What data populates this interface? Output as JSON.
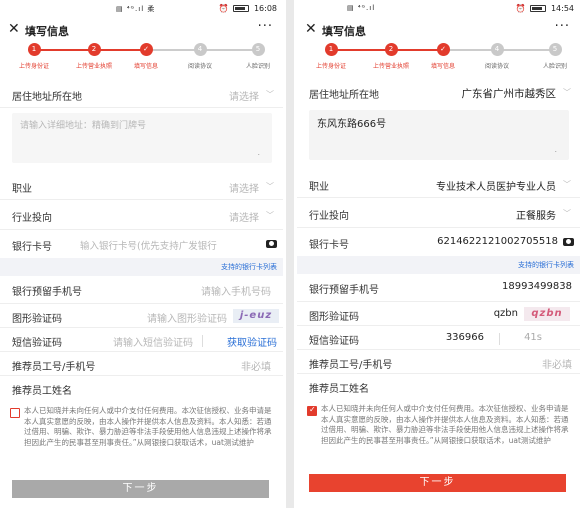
{
  "accent": "#e23b2c",
  "link_color": "#2a6fd6",
  "steps": [
    "上传身份证",
    "上传营业执照",
    "填写信息",
    "阅读协议",
    "人脸识别"
  ],
  "left": {
    "status": {
      "signal": "▤ ⁴ᴳ.ıl 柔",
      "time": "16:08",
      "battery_fraction": 0.7
    },
    "nav": {
      "close": "✕",
      "title": "填写信息",
      "more": "···"
    },
    "residence": {
      "label": "居住地址所在地",
      "value": "请选择"
    },
    "address_placeholder": "请输入详细地址：精确到门牌号",
    "occupation": {
      "label": "职业",
      "value": "请选择"
    },
    "industry": {
      "label": "行业投向",
      "value": "请选择"
    },
    "bank_card": {
      "label": "银行卡号",
      "placeholder": "输入银行卡号(优先支持广发银行"
    },
    "bank_hint": "支持的银行卡列表",
    "reserved_phone": {
      "label": "银行预留手机号",
      "placeholder": "请输入手机号码"
    },
    "captcha": {
      "label": "图形验证码",
      "placeholder": "请输入图形验证码",
      "image_text": "j-euz"
    },
    "sms": {
      "label": "短信验证码",
      "placeholder": "请输入短信验证码",
      "button": "获取验证码"
    },
    "referrer_id": {
      "label": "推荐员工号/手机号",
      "placeholder": "非必填"
    },
    "referrer_name": {
      "label": "推荐员工姓名"
    },
    "agreement": "本人已知晓并未向任何人或中介支付任何费用。本次征信授权、业务申请是本人真实意愿的反映，由本人操作并提供本人信息及资料。本人知悉：若通过借用、明骗、欺诈、暴力胁迫等非法手段使用他人信息违规上述操作将承担因此产生的民事甚至刑事责任。”从网银接口获取话术，uat测试维护",
    "next": "下一步"
  },
  "right": {
    "status": {
      "signal": "▤ ⁴ᴳ.ıl",
      "time": "14:54",
      "battery_fraction": 0.7
    },
    "nav": {
      "close": "✕",
      "title": "填写信息",
      "more": "···"
    },
    "residence": {
      "label": "居住地址所在地",
      "value": "广东省广州市越秀区"
    },
    "address_value": "东风东路666号",
    "occupation": {
      "label": "职业",
      "value": "专业技术人员医护专业人员"
    },
    "industry": {
      "label": "行业投向",
      "value": "正餐服务"
    },
    "bank_card": {
      "label": "银行卡号",
      "value": "6214622121002705518"
    },
    "bank_hint": "支持的银行卡列表",
    "reserved_phone": {
      "label": "银行预留手机号",
      "value": "18993499838"
    },
    "captcha": {
      "label": "图形验证码",
      "value": "qzbn",
      "image_text": "qzbn"
    },
    "sms": {
      "label": "短信验证码",
      "value": "336966",
      "button": "41s"
    },
    "referrer_id": {
      "label": "推荐员工号/手机号",
      "placeholder": "非必填"
    },
    "referrer_name": {
      "label": "推荐员工姓名"
    },
    "agreement": "本人已知晓并未向任何人或中介支付任何费用。本次征信授权、业务申请是本人真实意愿的反映，由本人操作并提供本人信息及资料。本人知悉：若通过借用、明骗、欺诈、暴力胁迫等非法手段使用他人信息违规上述操作将承担因此产生的民事甚至刑事责任。”从网银接口获取话术，uat测试维护",
    "next": "下一步"
  }
}
